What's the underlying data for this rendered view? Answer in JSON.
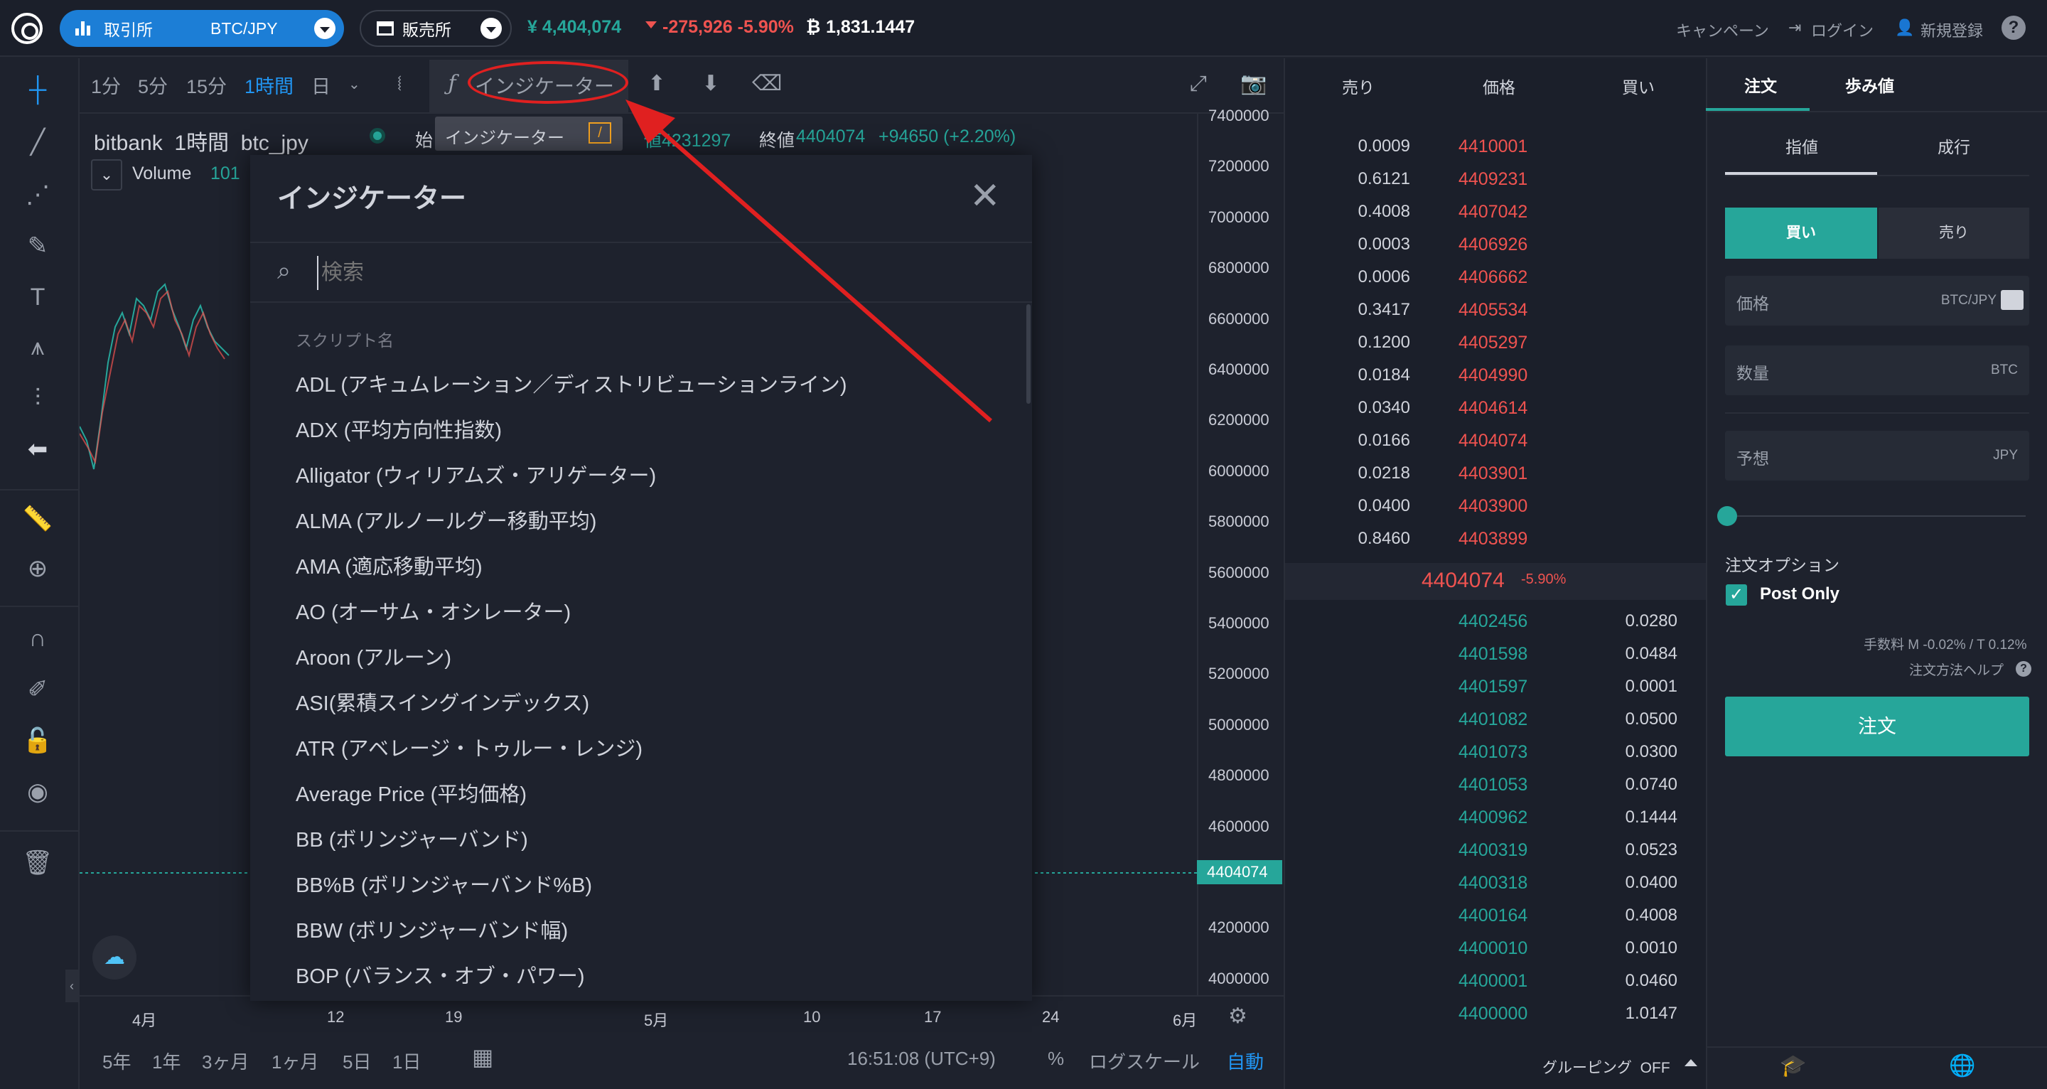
{
  "header": {
    "exchange_label": "取引所",
    "pair_label": "BTC/JPY",
    "shop_label": "販売所",
    "price": "¥ 4,404,074",
    "change": "-275,926 -5.90%",
    "volume": "1,831.1447",
    "campaign": "キャンペーン",
    "login": "ログイン",
    "register": "新規登録",
    "help": "?"
  },
  "toolbar": {
    "timeframes": [
      "1分",
      "5分",
      "15分",
      "1時間",
      "日"
    ],
    "active_timeframe": "1時間",
    "indicator_label": "インジケーター",
    "tooltip_label": "インジケーター",
    "tooltip_key": "/"
  },
  "legend": {
    "symbol": "bitbank",
    "interval": "1時間",
    "pair": "btc_jpy",
    "start_label": "始",
    "low_value": "値4231297",
    "close_label": "終値",
    "close_value": "4404074",
    "change": "+94650 (+2.20%)",
    "volume_label": "Volume",
    "volume_value": "101"
  },
  "chart": {
    "y_ticks": [
      "7400000",
      "7200000",
      "7000000",
      "6800000",
      "6600000",
      "6400000",
      "6200000",
      "6000000",
      "5800000",
      "5600000",
      "5400000",
      "5200000",
      "5000000",
      "4800000",
      "4600000",
      "4400000",
      "4200000",
      "4000000"
    ],
    "current_price": "4404074",
    "x_ticks": [
      "4月",
      "12",
      "19",
      "5月",
      "10",
      "17",
      "24",
      "6月"
    ]
  },
  "indicator_dialog": {
    "title": "インジケーター",
    "search_placeholder": "検索",
    "section_label": "スクリプト名",
    "items": [
      "ADL (アキュムレーション／ディストリビューションライン)",
      "ADX (平均方向性指数)",
      "Alligator (ウィリアムズ・アリゲーター)",
      "ALMA (アルノールグー移動平均)",
      "AMA (適応移動平均)",
      "AO (オーサム・オシレーター)",
      "Aroon (アルーン)",
      "ASI(累積スイングインデックス)",
      "ATR (アベレージ・トゥルー・レンジ)",
      "Average Price (平均価格)",
      "BB (ボリンジャーバンド)",
      "BB%B (ボリンジャーバンド%B)",
      "BBW (ボリンジャーバンド幅)",
      "BOP (バランス・オブ・パワー)"
    ]
  },
  "bottom_bar": {
    "ranges": [
      "5年",
      "1年",
      "3ヶ月",
      "1ヶ月",
      "5日",
      "1日"
    ],
    "time": "16:51:08 (UTC+9)",
    "percent": "%",
    "log_scale": "ログスケール",
    "auto": "自動"
  },
  "orderbook": {
    "headers": [
      "売り",
      "価格",
      "買い"
    ],
    "asks": [
      {
        "qty": "0.0009",
        "price": "4410001"
      },
      {
        "qty": "0.6121",
        "price": "4409231"
      },
      {
        "qty": "0.4008",
        "price": "4407042"
      },
      {
        "qty": "0.0003",
        "price": "4406926"
      },
      {
        "qty": "0.0006",
        "price": "4406662"
      },
      {
        "qty": "0.3417",
        "price": "4405534"
      },
      {
        "qty": "0.1200",
        "price": "4405297"
      },
      {
        "qty": "0.0184",
        "price": "4404990"
      },
      {
        "qty": "0.0340",
        "price": "4404614"
      },
      {
        "qty": "0.0166",
        "price": "4404074"
      },
      {
        "qty": "0.0218",
        "price": "4403901"
      },
      {
        "qty": "0.0400",
        "price": "4403900"
      },
      {
        "qty": "0.8460",
        "price": "4403899"
      }
    ],
    "mid_price": "4404074",
    "mid_change": "-5.90%",
    "bids": [
      {
        "price": "4402456",
        "qty": "0.0280"
      },
      {
        "price": "4401598",
        "qty": "0.0484"
      },
      {
        "price": "4401597",
        "qty": "0.0001"
      },
      {
        "price": "4401082",
        "qty": "0.0500"
      },
      {
        "price": "4401073",
        "qty": "0.0300"
      },
      {
        "price": "4401053",
        "qty": "0.0740"
      },
      {
        "price": "4400962",
        "qty": "0.1444"
      },
      {
        "price": "4400319",
        "qty": "0.0523"
      },
      {
        "price": "4400318",
        "qty": "0.0400"
      },
      {
        "price": "4400164",
        "qty": "0.4008"
      },
      {
        "price": "4400010",
        "qty": "0.0010"
      },
      {
        "price": "4400001",
        "qty": "0.0460"
      },
      {
        "price": "4400000",
        "qty": "1.0147"
      }
    ],
    "grouping": "グルーピング  OFF"
  },
  "order_panel": {
    "tabs": [
      "注文",
      "歩み値"
    ],
    "type_tabs": [
      "指値",
      "成行"
    ],
    "buy": "買い",
    "sell": "売り",
    "price_label": "価格",
    "price_unit": "BTC/JPY",
    "amount_label": "数量",
    "amount_unit": "BTC",
    "estimate_label": "予想",
    "estimate_unit": "JPY",
    "options_label": "注文オプション",
    "post_only": "Post Only",
    "fee": "手数料 M -0.02% / T 0.12%",
    "order_help": "注文方法ヘルプ",
    "submit": "注文"
  },
  "colors": {
    "up": "#26a69a",
    "down": "#ef5350",
    "accent": "#2196f3",
    "annotation": "#e02020"
  }
}
